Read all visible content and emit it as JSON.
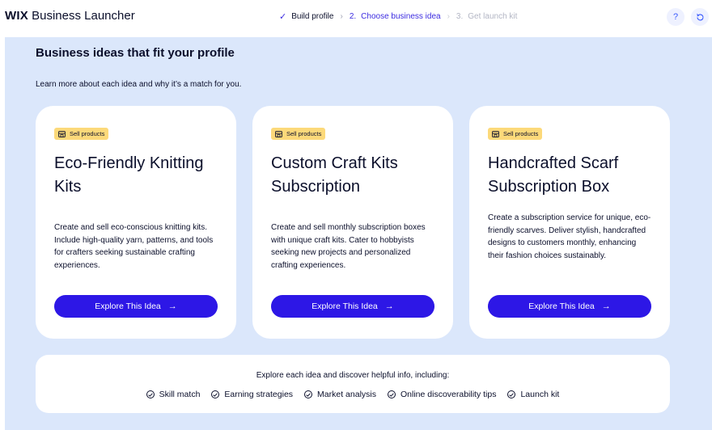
{
  "header": {
    "brand_bold": "WIX",
    "brand_rest": "Business Launcher",
    "steps": [
      {
        "label": "Build profile",
        "state": "done",
        "marker": "✓"
      },
      {
        "label": "Choose business idea",
        "state": "active",
        "marker": "2."
      },
      {
        "label": "Get launch kit",
        "state": "inactive",
        "marker": "3."
      }
    ],
    "help_label": "?",
    "refresh_icon": "refresh-icon"
  },
  "main": {
    "title": "Business ideas that fit your profile",
    "subtitle": "Learn more about each idea and why it’s a match for you.",
    "cards": [
      {
        "badge": "Sell products",
        "title": "Eco-Friendly Knitting Kits",
        "description": "Create and sell eco-conscious knitting kits. Include high-quality yarn, patterns, and tools for crafters seeking sustainable crafting experiences.",
        "button": "Explore This Idea"
      },
      {
        "badge": "Sell products",
        "title": "Custom Craft Kits Subscription",
        "description": "Create and sell monthly subscription boxes with unique craft kits. Cater to hobbyists seeking new projects and personalized crafting experiences.",
        "button": "Explore This Idea"
      },
      {
        "badge": "Sell products",
        "title": "Handcrafted Scarf Subscription Box",
        "description": "Create a subscription service for unique, eco-friendly scarves. Deliver stylish, handcrafted designs to customers monthly, enhancing their fashion choices sustainably.",
        "button": "Explore This Idea"
      }
    ]
  },
  "info": {
    "heading": "Explore each idea and discover helpful info, including:",
    "features": [
      "Skill match",
      "Earning strategies",
      "Market analysis",
      "Online discoverability tips",
      "Launch kit"
    ]
  },
  "colors": {
    "accent": "#2d17e6",
    "panel_bg": "#dbe7fb",
    "badge_bg": "#fcd97a"
  }
}
